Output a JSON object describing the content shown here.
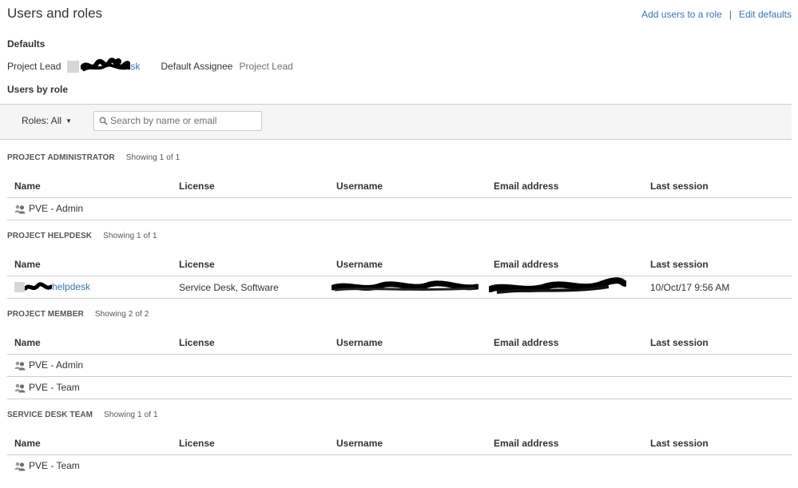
{
  "page": {
    "title": "Users and roles",
    "links": {
      "add_users": "Add users to a role",
      "separator": "|",
      "edit_defaults": "Edit defaults"
    }
  },
  "defaults": {
    "heading": "Defaults",
    "project_lead_label": "Project Lead",
    "project_lead_visible_suffix": "sk",
    "default_assignee_label": "Default Assignee",
    "default_assignee_value": "Project Lead"
  },
  "users_by_role": {
    "heading": "Users by role",
    "roles_filter": "Roles: All",
    "search_placeholder": "Search by name or email"
  },
  "columns": [
    "Name",
    "License",
    "Username",
    "Email address",
    "Last session"
  ],
  "sections": [
    {
      "title": "PROJECT ADMINISTRATOR",
      "showing": "Showing 1 of 1",
      "rows": [
        {
          "name": "PVE - Admin",
          "type": "group",
          "license": "",
          "username": "",
          "email": "",
          "last_session": ""
        }
      ]
    },
    {
      "title": "PROJECT HELPDESK",
      "showing": "Showing 1 of 1",
      "rows": [
        {
          "name": "helpdesk",
          "type": "user",
          "license": "Service Desk, Software",
          "username": "",
          "email": "",
          "last_session": "10/Oct/17 9:56 AM"
        }
      ]
    },
    {
      "title": "PROJECT MEMBER",
      "showing": "Showing 2 of 2",
      "rows": [
        {
          "name": "PVE - Admin",
          "type": "group",
          "license": "",
          "username": "",
          "email": "",
          "last_session": ""
        },
        {
          "name": "PVE - Team",
          "type": "group",
          "license": "",
          "username": "",
          "email": "",
          "last_session": ""
        }
      ]
    },
    {
      "title": "SERVICE DESK TEAM",
      "showing": "Showing 1 of 1",
      "rows": [
        {
          "name": "PVE - Team",
          "type": "group",
          "license": "",
          "username": "",
          "email": "",
          "last_session": ""
        }
      ]
    }
  ],
  "icons": {
    "group": "group-icon",
    "user": "user-avatar-icon",
    "search": "search-icon",
    "dropdown": "caret-down-icon"
  },
  "colors": {
    "link": "#3b73af",
    "border": "#cccccc",
    "filter_bar": "#f5f5f5",
    "redaction": "#000000"
  }
}
